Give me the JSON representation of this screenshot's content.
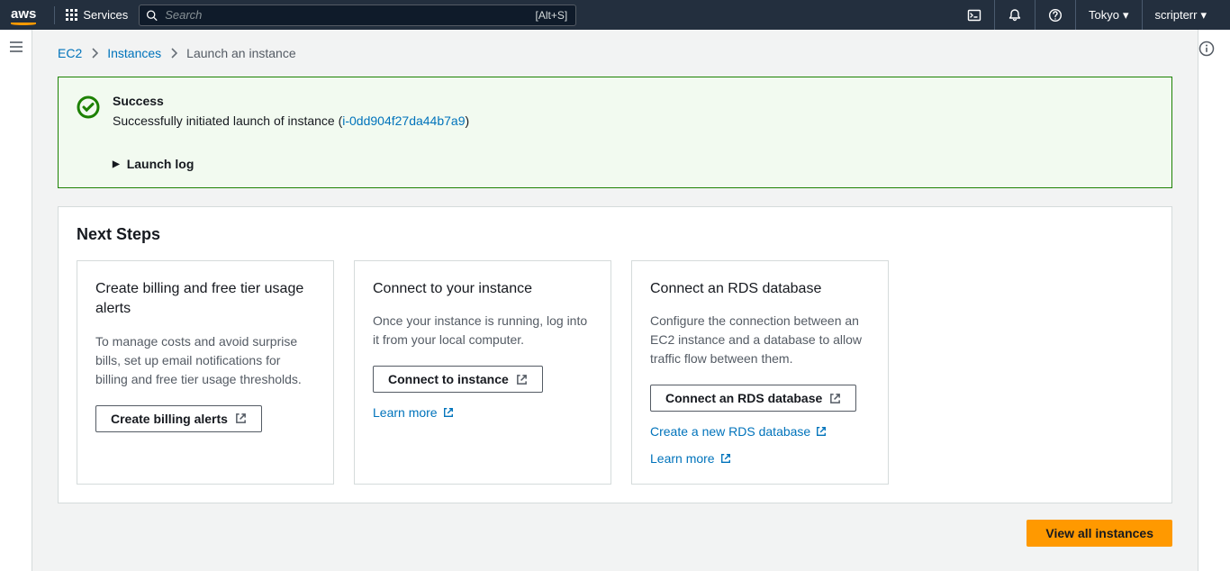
{
  "top": {
    "logo": "aws",
    "services": "Services",
    "search_placeholder": "Search",
    "search_hint": "[Alt+S]",
    "region": "Tokyo",
    "user": "scripterr"
  },
  "breadcrumb": {
    "root": "EC2",
    "level1": "Instances",
    "current": "Launch an instance"
  },
  "success": {
    "title": "Success",
    "msg_prefix": "Successfully initiated launch of instance (",
    "instance_id": "i-0dd904f27da44b7a9",
    "msg_suffix": ")",
    "launch_log": "Launch log"
  },
  "next_steps": {
    "title": "Next Steps",
    "cards": [
      {
        "title": "Create billing and free tier usage alerts",
        "desc": "To manage costs and avoid surprise bills, set up email notifications for billing and free tier usage thresholds.",
        "button": "Create billing alerts"
      },
      {
        "title": "Connect to your instance",
        "desc": "Once your instance is running, log into it from your local computer.",
        "button": "Connect to instance",
        "learn_more": "Learn more"
      },
      {
        "title": "Connect an RDS database",
        "desc": "Configure the connection between an EC2 instance and a database to allow traffic flow between them.",
        "button": "Connect an RDS database",
        "link1": "Create a new RDS database",
        "learn_more": "Learn more"
      }
    ]
  },
  "footer": {
    "view_all": "View all instances"
  }
}
